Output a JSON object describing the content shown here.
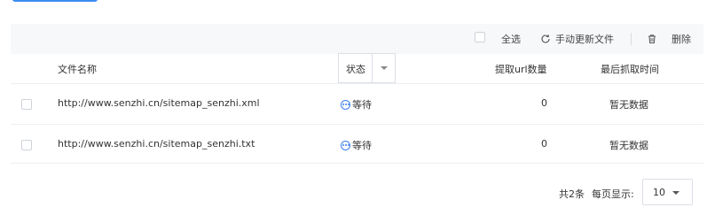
{
  "toolbar": {
    "select_all": "全选",
    "refresh": "手动更新文件",
    "delete": "删除"
  },
  "table": {
    "headers": {
      "filename": "文件名称",
      "status": "状态",
      "url_count": "提取url数量",
      "last_crawl": "最后抓取时间"
    },
    "rows": [
      {
        "filename": "http://www.senzhi.cn/sitemap_senzhi.xml",
        "status": "等待",
        "url_count": "0",
        "last_crawl": "暂无数据"
      },
      {
        "filename": "http://www.senzhi.cn/sitemap_senzhi.txt",
        "status": "等待",
        "url_count": "0",
        "last_crawl": "暂无数据"
      }
    ]
  },
  "pagination": {
    "total": "共2条",
    "per_page_label": "每页显示:",
    "page_size": "10"
  },
  "colors": {
    "primary": "#3b8cf0",
    "toolbar_bg": "#f7f8fa",
    "status_icon": "#3d7ff0"
  }
}
